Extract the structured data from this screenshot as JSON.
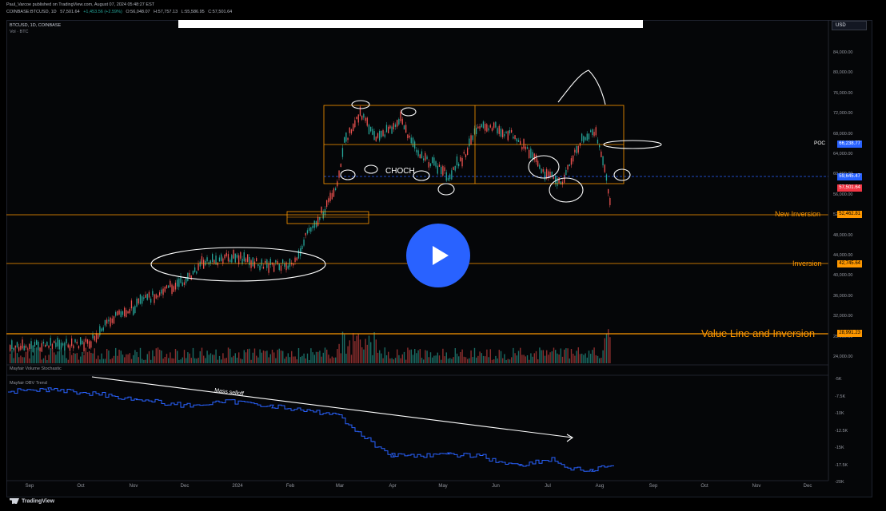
{
  "header": {
    "line1": "Paul_Varcoe published on TradingView.com, August 07, 2024 05:48:27 EST",
    "ticker": "COINBASE:BTCUSD, 1D",
    "last": "57,501.64",
    "change": "+1,453.56 (+2.59%)",
    "open": "O:56,048.07",
    "high": "H:57,757.13",
    "low": "L:55,586.95",
    "close": "C:57,501.64"
  },
  "chart": {
    "symbol_label": "BTCUSD, 1D, COINBASE",
    "vol_label": "Vol · BTC",
    "currency": "USD",
    "price_ticks": [
      "84,000.00",
      "80,000.00",
      "76,000.00",
      "72,000.00",
      "68,000.00",
      "64,000.00",
      "60,000.00",
      "56,000.00",
      "52,000.00",
      "48,000.00",
      "44,000.00",
      "40,000.00",
      "36,000.00",
      "32,000.00",
      "28,000.00",
      "24,000.00"
    ],
    "poc_label": "POC",
    "poc_value": "66,238.77",
    "dotted_value": "59,645.47",
    "last_value": "57,501.64",
    "new_inversion_label": "New Inversion",
    "new_inversion_value": "52,462.81",
    "inversion_label": "Inversion",
    "inversion_value": "42,745.64",
    "value_line_label": "Value Line and Inversion",
    "value_line_value": "28,991.23",
    "choch_label": "CHOCH"
  },
  "indicator": {
    "title1": "Mayfair Volume Stochastic",
    "title2": "Mayfair OBV Trend",
    "annotation": "Mass selloff",
    "ticks": [
      "-5K",
      "-7.5K",
      "-10K",
      "-12.5K",
      "-15K",
      "-17.5K",
      "-20K"
    ]
  },
  "time_axis": {
    "months": [
      "Sep",
      "Oct",
      "Nov",
      "Dec",
      "2024",
      "Feb",
      "Mar",
      "Apr",
      "May",
      "Jun",
      "Jul",
      "Aug",
      "Sep",
      "Oct",
      "Nov",
      "Dec"
    ]
  },
  "brand": "TradingView",
  "colors": {
    "orange": "#ff9800",
    "poc_blue": "#2962ff",
    "last_red": "#f23645",
    "play_blue": "#2962ff",
    "indicator_line": "#2962ff"
  }
}
